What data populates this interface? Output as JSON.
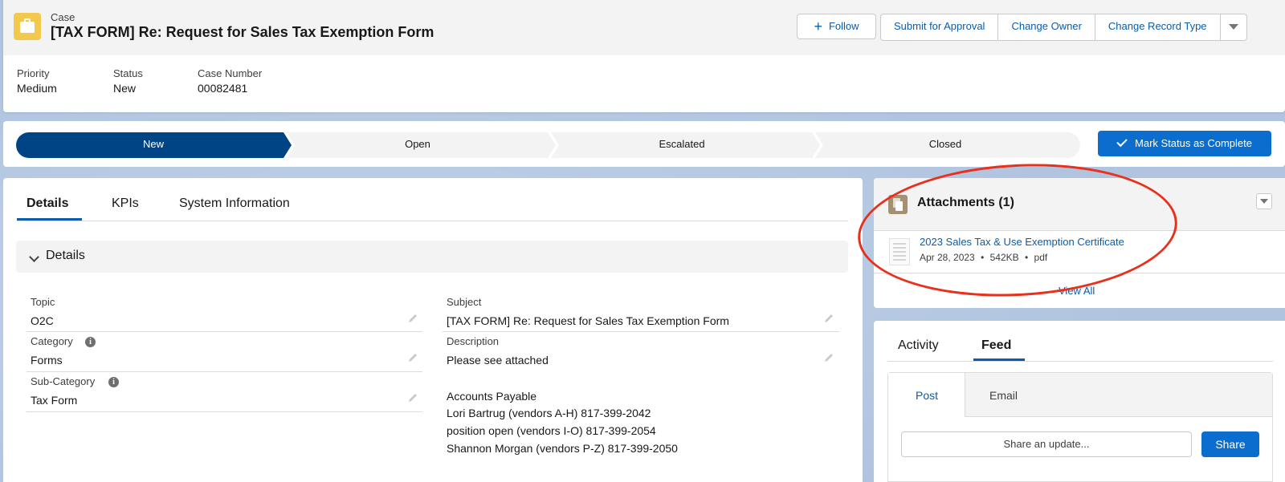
{
  "header": {
    "object_label": "Case",
    "title": "[TAX FORM] Re: Request for Sales Tax Exemption Form",
    "actions": {
      "follow": "Follow",
      "submit_for_approval": "Submit for Approval",
      "change_owner": "Change Owner",
      "change_record_type": "Change Record Type"
    },
    "highlights": [
      {
        "label": "Priority",
        "value": "Medium"
      },
      {
        "label": "Status",
        "value": "New"
      },
      {
        "label": "Case Number",
        "value": "00082481"
      }
    ]
  },
  "path": {
    "stages": [
      "New",
      "Open",
      "Escalated",
      "Closed"
    ],
    "current_index": 0,
    "mark_complete": "Mark Status as Complete",
    "colors": {
      "current": "#014486",
      "other": "#f3f3f3"
    }
  },
  "details": {
    "tabs": [
      "Details",
      "KPIs",
      "System Information"
    ],
    "section_title": "Details",
    "left_fields": [
      {
        "label": "Topic",
        "value": "O2C"
      },
      {
        "label": "Category",
        "value": "Forms"
      },
      {
        "label": "Sub-Category",
        "value": "Tax Form"
      }
    ],
    "subject": {
      "label": "Subject",
      "value": "[TAX FORM] Re: Request for Sales Tax Exemption Form"
    },
    "description": {
      "label": "Description",
      "lines": [
        "Please see attached",
        "Accounts Payable",
        "Lori Bartrug (vendors A-H) 817-399-2042",
        "position open (vendors I-O) 817-399-2054",
        "Shannon Morgan (vendors P-Z) 817-399-2050"
      ]
    }
  },
  "attachments": {
    "title": "Attachments (1)",
    "files": [
      {
        "name": "2023 Sales Tax & Use Exemption Certificate",
        "date": "Apr 28, 2023",
        "size": "542KB",
        "type": "pdf"
      }
    ],
    "view_all": "View All"
  },
  "feed": {
    "tabs": [
      "Activity",
      "Feed"
    ],
    "publisher_tabs": [
      "Post",
      "Email"
    ],
    "share_placeholder": "Share an update...",
    "share_button": "Share"
  },
  "colors": {
    "brand": "#0b6dce",
    "link": "#0b5cab",
    "annotation": "#e8301c",
    "case_icon": "#f2c94c"
  }
}
